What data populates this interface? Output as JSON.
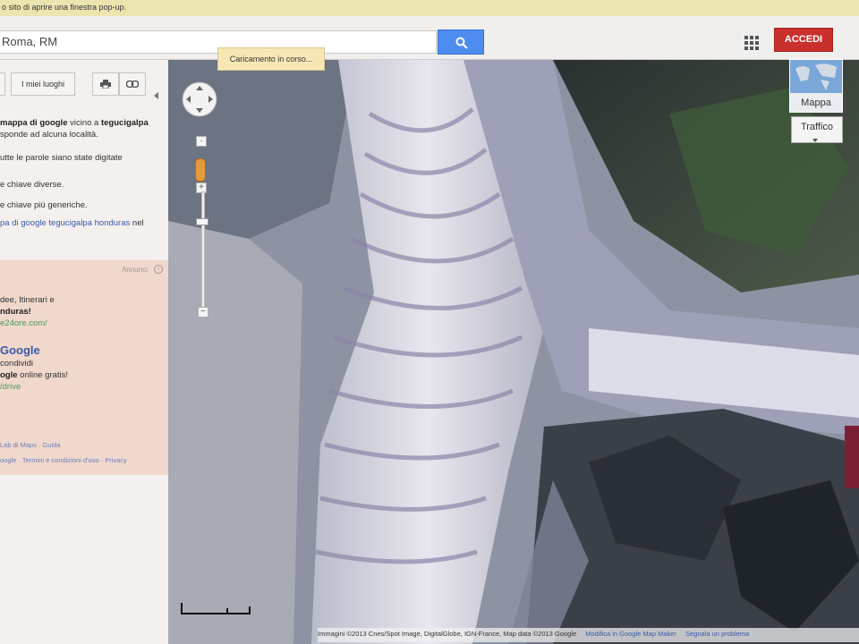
{
  "popup_notice": "o sito di aprire una finestra pop-up.",
  "search": {
    "value": "Roma, RM"
  },
  "header": {
    "signin_label": "ACCEDI"
  },
  "toolbar": {
    "my_places_label": "I miei luoghi"
  },
  "results": {
    "line1_bold1": "mappa di google",
    "line1_mid": " vicino a ",
    "line1_bold2": "tegucigalpa",
    "line2": "sponde ad alcuna località.",
    "line3": "utte le parole siano state digitate",
    "line4": "e chiave diverse.",
    "line5": "e chiave più generiche.",
    "line6_link": "pa di google tegucigalpa honduras",
    "line6_tail": " nel"
  },
  "ad": {
    "label": "Annunci",
    "line1": "dee, Itinerari e",
    "line2_bold": "nduras!",
    "line3": "e24ore.com/",
    "title": "Google",
    "line4": "condividi",
    "line5_bold": "ogle",
    "line5_tail": " online gratis!",
    "line6": "/drive"
  },
  "footer": {
    "line1": "Lab di Maps · Guida",
    "line2": "oogle · Termini e condizioni d'uso · Privacy"
  },
  "map": {
    "loading_text": "Caricamento in corso...",
    "map_type_label": "Mappa",
    "traffic_label": "Traffico",
    "attribution": "Immagini ©2013 Cnes/Spot Image, DigitalGlobe, IGN-France, Map data ©2013 Google",
    "attribution_links": [
      "Modifica in Google Map Maker",
      "Segnala un problema"
    ]
  },
  "colors": {
    "accent_blue": "#4e8cf0",
    "signin_red": "#c9302c"
  }
}
